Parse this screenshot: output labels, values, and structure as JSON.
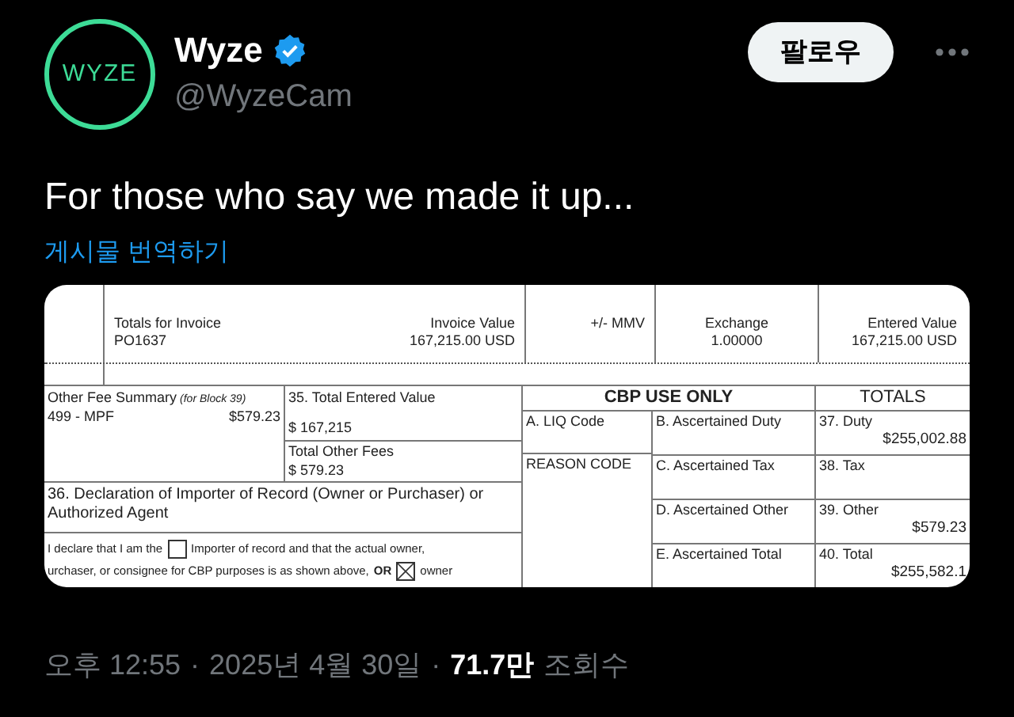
{
  "author": {
    "logo_text": "WYZE",
    "name": "Wyze",
    "verified": true,
    "handle": "@WyzeCam"
  },
  "follow_button": "팔로우",
  "text": "For those who say we made it up...",
  "translate_link": "게시물 번역하기",
  "document": {
    "invoice": {
      "label": "Totals for Invoice",
      "number": "PO1637",
      "value_label": "Invoice Value",
      "value": "167,215.00 USD",
      "mmv_label": "+/- MMV",
      "exchange_label": "Exchange",
      "exchange": "1.00000",
      "entered_label": "Entered Value",
      "entered": "167,215.00 USD"
    },
    "fee_summary": {
      "title": "Other Fee Summary",
      "note": "(for Block 39)",
      "code": "499 - MPF",
      "amount": "$579.23"
    },
    "total_entered": {
      "label": "35. Total Entered Value",
      "value": "$ 167,215"
    },
    "total_other_fees": {
      "label": "Total Other Fees",
      "value": "$ 579.23"
    },
    "declaration": {
      "title": "36. Declaration of Importer of Record (Owner or Purchaser) or Authorized Agent",
      "line_1_before": "I declare that I am the",
      "importer_checked": false,
      "line_1_after": "Importer of record and that the actual owner,",
      "line_2": "urchaser, or consignee for CBP purposes is as shown above,",
      "or": "OR",
      "owner_checked": true,
      "owner": "owner"
    },
    "cbp_title": "CBP USE ONLY",
    "totals_title": "TOTALS",
    "cbp_rows": [
      {
        "code": "A. LIQ Code",
        "ascertained": "B. Ascertained Duty",
        "total_label": "37. Duty",
        "total": "$255,002.88"
      },
      {
        "code": "REASON CODE",
        "ascertained": "C. Ascertained Tax",
        "total_label": "38. Tax"
      },
      {
        "ascertained": "D. Ascertained Other",
        "total_label": "39. Other",
        "total": "$579.23"
      },
      {
        "ascertained": "E. Ascertained Total",
        "total_label": "40. Total",
        "total": "$255,582.1"
      }
    ]
  },
  "footer": {
    "time": "오후 12:55",
    "separator_1": "·",
    "date": "2025년 4월 30일",
    "separator_2": "·",
    "views_count": "71.7만",
    "views_label": "조회수"
  }
}
